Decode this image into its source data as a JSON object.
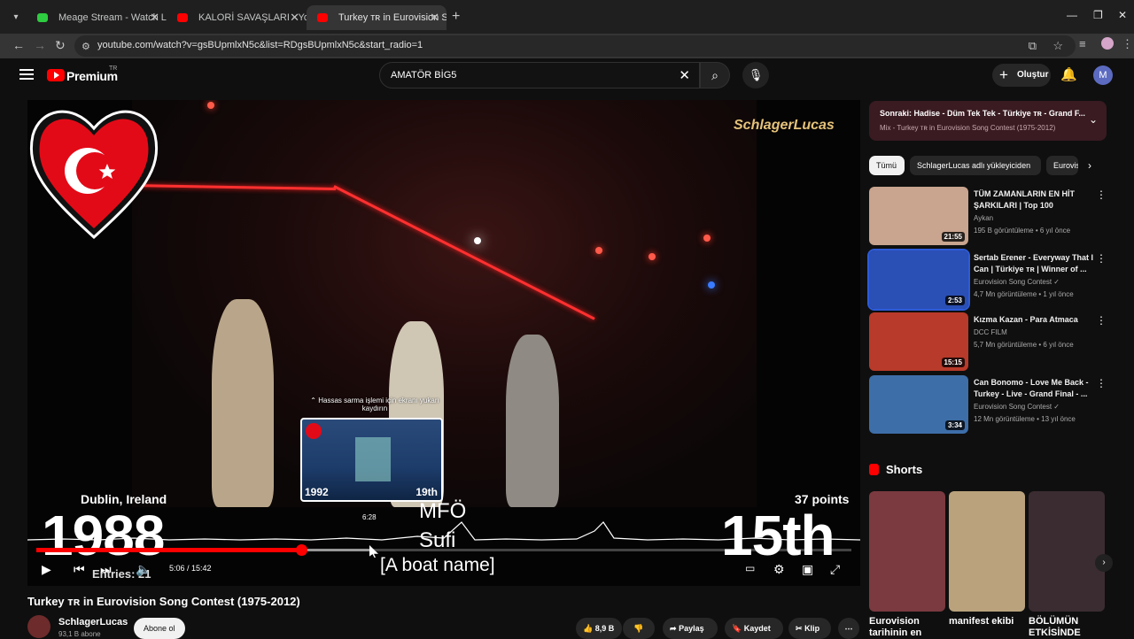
{
  "browser": {
    "tabs": [
      {
        "label": "Meage Stream - Watch Live on",
        "icon_color": "#2ecc40"
      },
      {
        "label": "KALORİ SAVAŞLARI - YouTube",
        "icon_color": "#ff0000"
      },
      {
        "label": "Turkey ᴛʀ in Eurovision Song C",
        "icon_color": "#ff0000"
      }
    ],
    "url": "youtube.com/watch?v=gsBUpmlxN5c&list=RDgsBUpmlxN5c&start_radio=1"
  },
  "header": {
    "logo_text": "Premium",
    "country_code": "TR",
    "search_value": "AMATÖR BİG5",
    "create_label": "Oluştur",
    "avatar_letter": "M"
  },
  "video": {
    "watermark": "SchlagerLucas",
    "fine_scrub_tip": "Hassas sarma işlemi için ekranı yukarı kaydırın",
    "preview": {
      "year": "1992",
      "rank": "19th",
      "time": "6:28"
    },
    "city": "Dublin, Ireland",
    "points": "37 points",
    "year": "1988",
    "rank": "15th",
    "artist_line1": "MFÖ",
    "artist_line2": "Sufi",
    "song_subtitle": "[A boat name]",
    "entries": "Entries: 21",
    "timecode": "5:06 / 15:42",
    "progress": 0.325,
    "buffered": 0.41,
    "title": "Turkey ᴛʀ in Eurovision Song Contest (1975-2012)"
  },
  "channel": {
    "name": "SchlagerLucas",
    "subs": "93,1 B abone",
    "subscribe_label": "Abone ol"
  },
  "actions": {
    "likes": "8,9 B",
    "share": "Paylaş",
    "save": "Kaydet",
    "clip": "Klip"
  },
  "next_up": {
    "title": "Sonraki: Hadise - Düm Tek Tek - Türkiye ᴛʀ - Grand F...",
    "subtitle": "Mix - Turkey ᴛʀ in Eurovision Song Contest (1975-2012)"
  },
  "chips": [
    "Tümü",
    "SchlagerLucas adlı yükleyiciden",
    "Eurovision"
  ],
  "recommendations": [
    {
      "title": "TÜM ZAMANLARIN EN HİT ŞARKILARI | Top 100",
      "channel": "Aykan",
      "meta": "195 B görüntüleme • 6 yıl önce",
      "duration": "21:55",
      "thumb": "#c9a48e"
    },
    {
      "title": "Sertab Erener - Everyway That I Can | Türkiye ᴛʀ | Winner of ...",
      "channel": "Eurovision Song Contest ✓",
      "meta": "4,7 Mn görüntüleme • 1 yıl önce",
      "duration": "2:53",
      "thumb": "#2a4fb5"
    },
    {
      "title": "Kızma Kazan - Para Atmaca",
      "channel": "DCC FILM",
      "meta": "5,7 Mn görüntüleme • 6 yıl önce",
      "duration": "15:15",
      "thumb": "#b83a2a"
    },
    {
      "title": "Can Bonomo - Love Me Back - Turkey - Live - Grand Final - ...",
      "channel": "Eurovision Song Contest ✓",
      "meta": "12 Mn görüntüleme • 13 yıl önce",
      "duration": "3:34",
      "thumb": "#3d6ea8"
    }
  ],
  "shorts": {
    "heading": "Shorts",
    "items": [
      {
        "title": "Eurovision tarihinin en",
        "thumb": "#7a3a3f"
      },
      {
        "title": "manifest ekibi",
        "thumb": "#b9a27c"
      },
      {
        "title": "BÖLÜMÜN ETKİSİNDE",
        "thumb": "#3b2c31"
      }
    ]
  }
}
